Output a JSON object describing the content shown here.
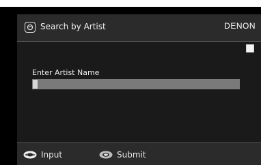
{
  "header": {
    "title": "Search by Artist",
    "brand": "DENON",
    "icon": "search-category-icon"
  },
  "form": {
    "label": "Enter Artist Name",
    "value": ""
  },
  "footer": {
    "input_label": "Input",
    "submit_label": "Submit",
    "input_icon": "dpad-arrows-icon",
    "submit_icon": "enter-button-icon"
  },
  "colors": {
    "background": "#1a1a1a",
    "header": "#2b2b2b",
    "field": "#7a7a7a"
  }
}
